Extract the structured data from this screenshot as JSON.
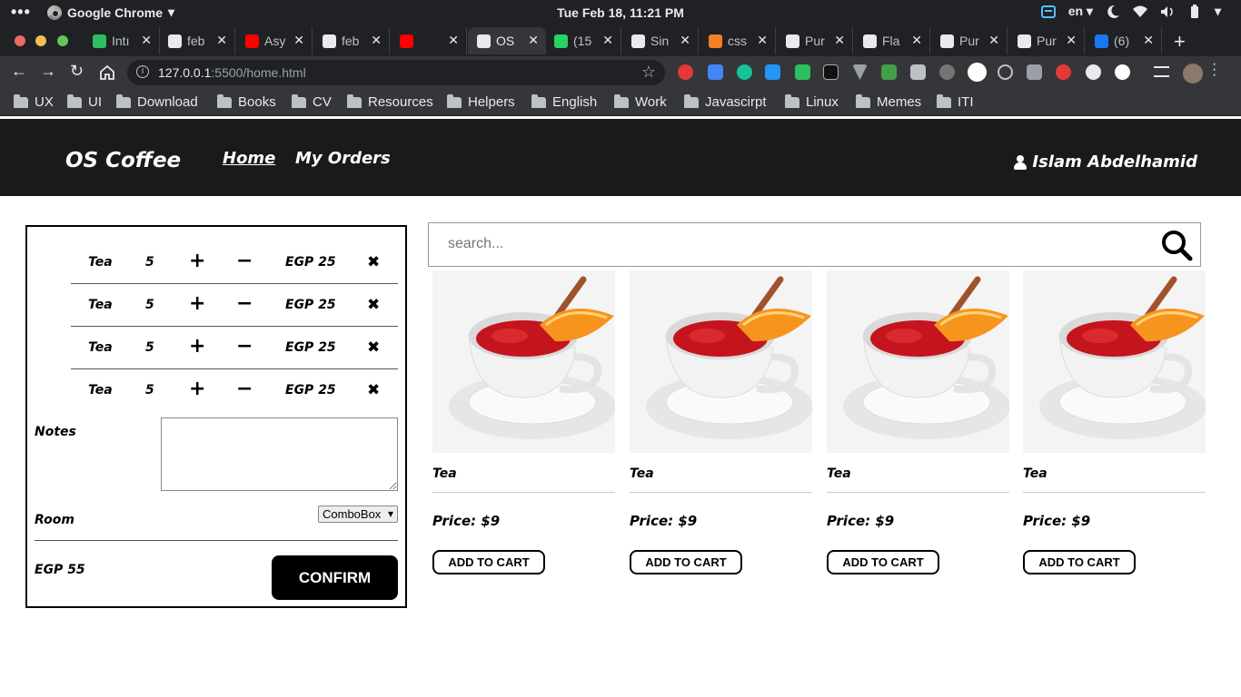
{
  "os": {
    "app_name": "Google Chrome",
    "clock": "Tue Feb 18, 11:21 PM",
    "language": "en"
  },
  "browser": {
    "tabs": [
      {
        "label": "Intı",
        "color": "#2dbe60"
      },
      {
        "label": "feb",
        "color": "#e8eaed"
      },
      {
        "label": "Asy",
        "color": "#ff0000"
      },
      {
        "label": "feb",
        "color": "#e8eaed"
      },
      {
        "label": "",
        "color": "#ff0000"
      },
      {
        "label": "OS",
        "color": "#e8eaed"
      },
      {
        "label": "(15",
        "color": "#25d366"
      },
      {
        "label": "Sin",
        "color": "#e8eaed"
      },
      {
        "label": "css",
        "color": "#f48024"
      },
      {
        "label": "Pur",
        "color": "#e8eaed"
      },
      {
        "label": "Fla",
        "color": "#e8eaed"
      },
      {
        "label": "Pur",
        "color": "#e8eaed"
      },
      {
        "label": "Pur",
        "color": "#e8eaed"
      },
      {
        "label": "(6)",
        "color": "#1877f2"
      }
    ],
    "url_host": "127.0.0.1",
    "url_path": ":5500/home.html",
    "bookmarks": [
      "UX",
      "UI",
      "Download",
      "Books",
      "CV",
      "Resources",
      "Helpers",
      "English",
      "Work",
      "Javascirpt",
      "Linux",
      "Memes",
      "ITI"
    ]
  },
  "header": {
    "brand": "OS Coffee",
    "nav": [
      "Home",
      "My Orders"
    ],
    "user_name": "Islam Abdelhamid"
  },
  "order": {
    "items": [
      {
        "name": "Tea",
        "qty": "5",
        "plus": "+",
        "minus": "−",
        "price": "EGP 25",
        "remove": "✖"
      },
      {
        "name": "Tea",
        "qty": "5",
        "plus": "+",
        "minus": "−",
        "price": "EGP 25",
        "remove": "✖"
      },
      {
        "name": "Tea",
        "qty": "5",
        "plus": "+",
        "minus": "−",
        "price": "EGP 25",
        "remove": "✖"
      },
      {
        "name": "Tea",
        "qty": "5",
        "plus": "+",
        "minus": "−",
        "price": "EGP 25",
        "remove": "✖"
      }
    ],
    "notes_label": "Notes",
    "room_label": "Room",
    "room_select": "ComboBox",
    "total": "EGP 55",
    "confirm_label": "CONFIRM"
  },
  "search": {
    "placeholder": "search..."
  },
  "products": [
    {
      "name": "Tea",
      "price": "Price: $9",
      "button": "ADD TO CART"
    },
    {
      "name": "Tea",
      "price": "Price: $9",
      "button": "ADD TO CART"
    },
    {
      "name": "Tea",
      "price": "Price: $9",
      "button": "ADD TO CART"
    },
    {
      "name": "Tea",
      "price": "Price: $9",
      "button": "ADD TO CART"
    }
  ]
}
